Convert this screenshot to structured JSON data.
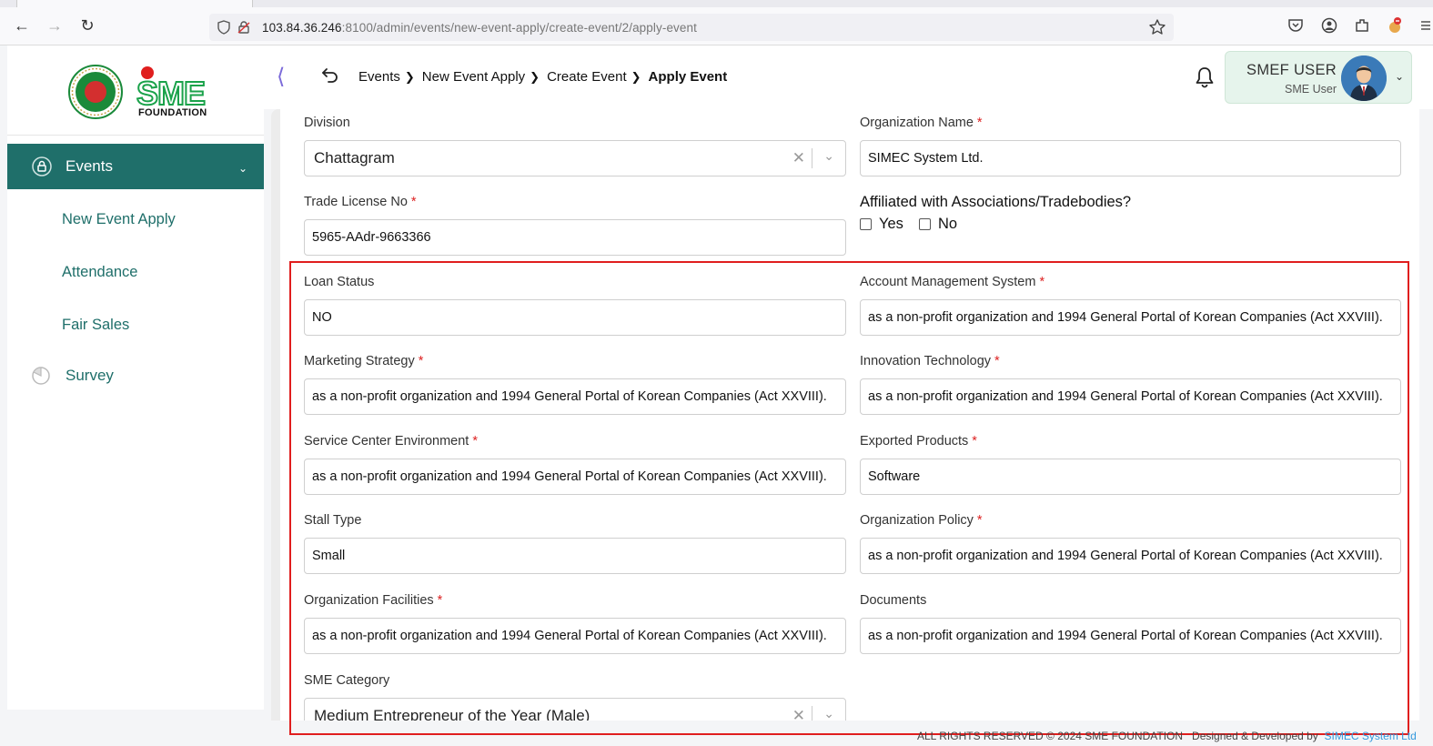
{
  "browser": {
    "url_host": "103.84.36.246",
    "url_rest": ":8100/admin/events/new-event-apply/create-event/2/apply-event"
  },
  "sidebar": {
    "logo_text": "SME",
    "logo_sub": "FOUNDATION",
    "events_label": "Events",
    "subitems": [
      "New Event Apply",
      "Attendance",
      "Fair Sales"
    ],
    "survey_label": "Survey"
  },
  "header": {
    "breadcrumb": [
      "Events",
      "New Event Apply",
      "Create Event",
      "Apply Event"
    ],
    "user_name": "SMEF USER",
    "user_role": "SME User"
  },
  "form": {
    "division": {
      "label": "Division",
      "value": "Chattagram"
    },
    "org_name": {
      "label": "Organization Name",
      "value": "SIMEC System Ltd."
    },
    "trade_license": {
      "label": "Trade License No",
      "value": "5965-AAdr-9663366"
    },
    "affiliated": {
      "question": "Affiliated with Associations/Tradebodies?",
      "yes": "Yes",
      "no": "No"
    },
    "loan_status": {
      "label": "Loan Status",
      "value": "NO"
    },
    "account_mgmt": {
      "label": "Account Management System",
      "value": "as a non-profit organization and 1994 General Portal of Korean Companies (Act XXVIII)."
    },
    "marketing": {
      "label": "Marketing Strategy",
      "value": "as a non-profit organization and 1994 General Portal of Korean Companies (Act XXVIII)."
    },
    "innovation": {
      "label": "Innovation Technology",
      "value": "as a non-profit organization and 1994 General Portal of Korean Companies (Act XXVIII)."
    },
    "service_center": {
      "label": "Service Center Environment",
      "value": "as a non-profit organization and 1994 General Portal of Korean Companies (Act XXVIII)."
    },
    "exported": {
      "label": "Exported Products",
      "value": "Software"
    },
    "stall_type": {
      "label": "Stall Type",
      "value": "Small"
    },
    "org_policy": {
      "label": "Organization Policy",
      "value": "as a non-profit organization and 1994 General Portal of Korean Companies (Act XXVIII)."
    },
    "org_facilities": {
      "label": "Organization Facilities",
      "value": "as a non-profit organization and 1994 General Portal of Korean Companies (Act XXVIII)."
    },
    "documents": {
      "label": "Documents",
      "value": "as a non-profit organization and 1994 General Portal of Korean Companies (Act XXVIII)."
    },
    "sme_category": {
      "label": "SME Category",
      "value": "Medium Entrepreneur of the Year (Male)"
    }
  },
  "footer": {
    "copyright": "ALL RIGHTS RESERVED © 2024 SME FOUNDATION",
    "designed": "Designed & Developed by",
    "brand": "SIMEC System Ltd"
  },
  "colors": {
    "primary": "#1f6f6a",
    "highlight": "#e01e1e",
    "required": "#d22222"
  }
}
